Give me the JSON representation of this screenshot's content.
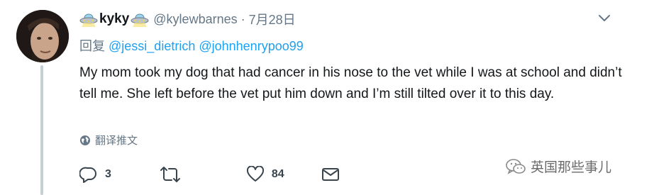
{
  "tweet": {
    "display_name": "kyky",
    "handle": "@kylewbarnes",
    "separator": "·",
    "timestamp": "7月28日",
    "reply_prefix": "回复",
    "reply_mentions": [
      "@jessi_dietrich",
      "@johnhenrypoo99"
    ],
    "text": "My mom took my dog that had cancer in his nose to the vet while I was at school and didn’t tell me. She left before the vet put him down and I’m still tilted over it to this day.",
    "translate_label": "翻译推文",
    "actions": {
      "reply_count": "3",
      "retweet_count": "",
      "like_count": "84"
    }
  },
  "watermark": {
    "text": "英国那些事儿"
  },
  "icons": {
    "name_emoji": "ufo-icon",
    "menu": "chevron-down-icon",
    "translate": "globe-icon",
    "reply": "reply-icon",
    "retweet": "retweet-icon",
    "like": "heart-icon",
    "dm": "envelope-icon",
    "watermark": "wechat-icon"
  },
  "colors": {
    "link": "#1da1f2",
    "secondary_text": "#657786",
    "thread_line": "#c4cfd6"
  }
}
